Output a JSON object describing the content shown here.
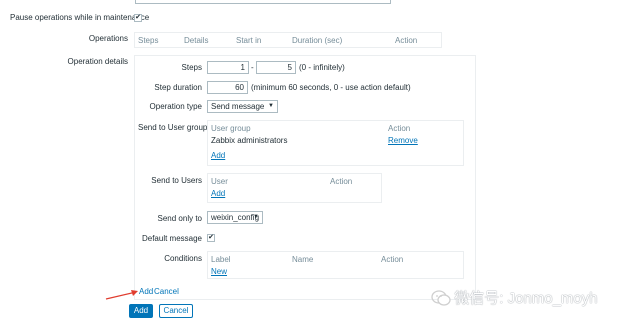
{
  "top_field": {
    "value": ""
  },
  "pause_maintenance": {
    "label": "Pause operations while in maintenance",
    "checked": true
  },
  "operations": {
    "label": "Operations",
    "columns": [
      "Steps",
      "Details",
      "Start in",
      "Duration (sec)",
      "Action"
    ]
  },
  "operation_details": {
    "label": "Operation details",
    "steps": {
      "label": "Steps",
      "from": "1",
      "separator": "-",
      "to": "5",
      "hint": "(0 - infinitely)"
    },
    "step_duration": {
      "label": "Step duration",
      "value": "60",
      "hint": "(minimum 60 seconds, 0 - use action default)"
    },
    "operation_type": {
      "label": "Operation type",
      "value": "Send message"
    },
    "send_to_user_groups": {
      "label": "Send to User groups",
      "col_group": "User group",
      "col_action": "Action",
      "rows": [
        {
          "name": "Zabbix administrators",
          "action": "Remove"
        }
      ],
      "add": "Add"
    },
    "send_to_users": {
      "label": "Send to Users",
      "col_user": "User",
      "col_action": "Action",
      "add": "Add"
    },
    "send_only_to": {
      "label": "Send only to",
      "value": "weixin_config"
    },
    "default_message": {
      "label": "Default message",
      "checked": true
    },
    "conditions": {
      "label": "Conditions",
      "col_label": "Label",
      "col_name": "Name",
      "col_action": "Action",
      "add": "New"
    },
    "footer_add": "Add",
    "footer_cancel": "Cancel"
  },
  "buttons": {
    "add": "Add",
    "cancel": "Cancel"
  },
  "watermark": {
    "text": "微信号: Jonmo_moyh"
  },
  "colors": {
    "link": "#0275b8",
    "border": "#ebeef0",
    "header_text": "#768d99",
    "arrow": "#e03c2e"
  }
}
